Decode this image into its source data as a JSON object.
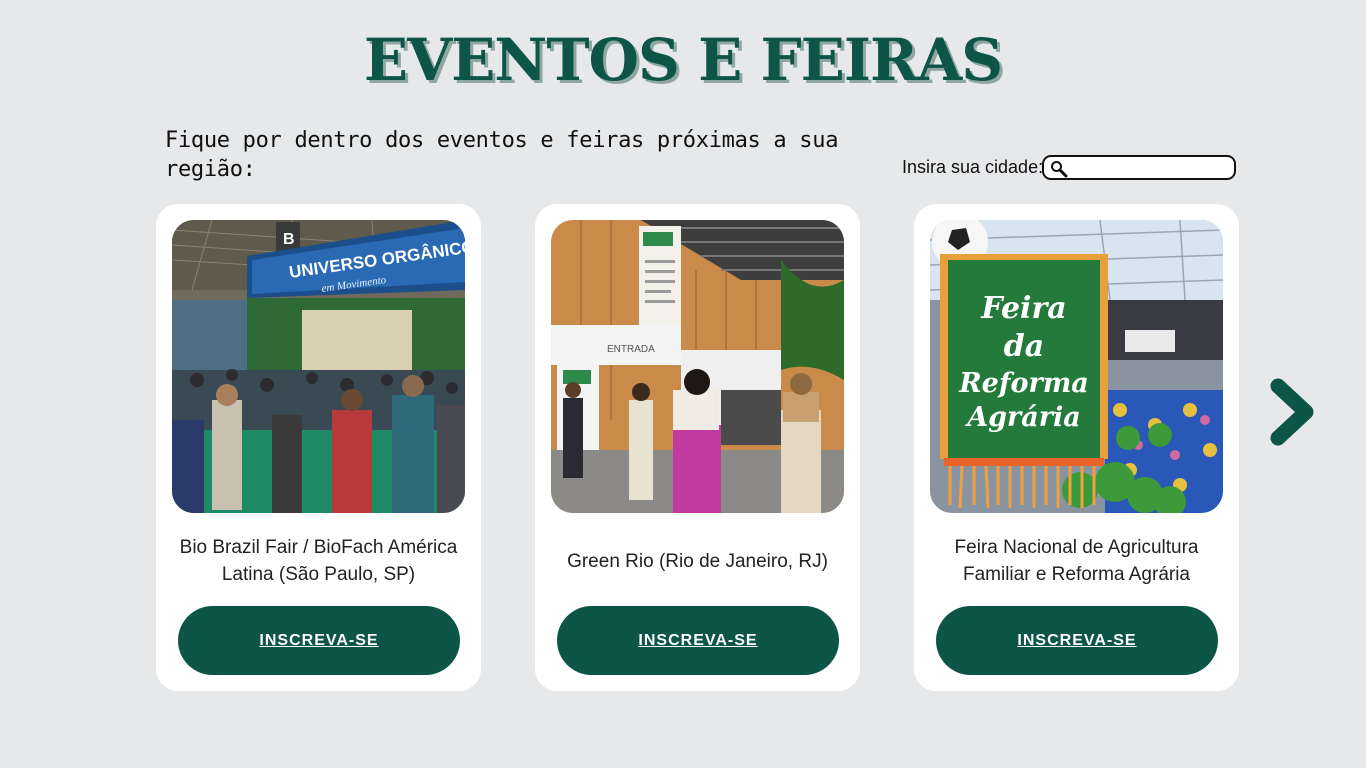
{
  "header": {
    "title": "EVENTOS E FEIRAS",
    "subtitle": "Fique por dentro dos eventos e feiras próximas a sua região:"
  },
  "search": {
    "label": "Insira sua cidade:",
    "value": "",
    "placeholder": "",
    "icon": "search-icon"
  },
  "events": [
    {
      "name": "Bio Brazil Fair / BioFach América Latina (São Paulo, SP)",
      "button": "INSCREVA-SE",
      "photo_sign": "UNIVERSO ORGÂNICO",
      "photo_sign_sub": "em Movimento"
    },
    {
      "name": "Green Rio (Rio de Janeiro, RJ)",
      "button": "INSCREVA-SE",
      "photo_sign": "ENTRADA"
    },
    {
      "name": "Feira Nacional de Agricultura Familiar e Reforma Agrária",
      "button": "INSCREVA-SE",
      "photo_banner": [
        "Feira",
        "da",
        "Reforma",
        "Agrária"
      ]
    }
  ],
  "navigation": {
    "next_icon": "chevron-right-icon"
  },
  "colors": {
    "brand": "#0d5546",
    "background": "#e6e8ea",
    "card": "#ffffff"
  }
}
